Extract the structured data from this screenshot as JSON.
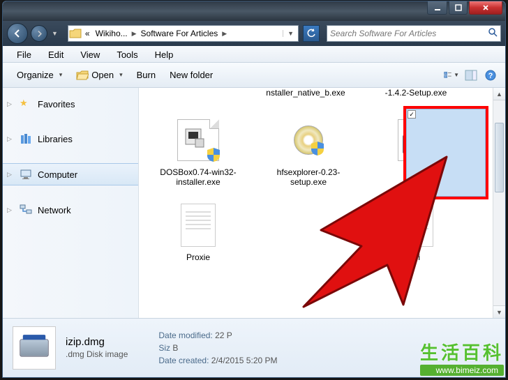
{
  "titlebar": {},
  "nav": {
    "chevrons": "«",
    "crumb1": "Wikiho...",
    "crumb2": "Software For Articles"
  },
  "search": {
    "placeholder": "Search Software For Articles"
  },
  "menu": {
    "file": "File",
    "edit": "Edit",
    "view": "View",
    "tools": "Tools",
    "help": "Help"
  },
  "toolbar": {
    "organize": "Organize",
    "open": "Open",
    "burn": "Burn",
    "newfolder": "New folder"
  },
  "sidebar": {
    "items": [
      {
        "label": "Favorites"
      },
      {
        "label": "Libraries"
      },
      {
        "label": "Computer"
      },
      {
        "label": "Network"
      }
    ]
  },
  "files": {
    "partial1": "nstaller_native_b.exe",
    "partial2": "-1.4.2-Setup.exe",
    "item1": "DOSBox0.74-win32-installer.exe",
    "item2": "hfsexplorer-0.23-setup.exe",
    "item3": "izip.dmg",
    "item4": "Proxie",
    "item5": "ini"
  },
  "details": {
    "filename": "izip.dmg",
    "filetype": ".dmg Disk image",
    "modified_label": "Date modified:",
    "modified_value": "22 P",
    "size_label": "Siz",
    "size_value": "B",
    "created_label": "Date created:",
    "created_value": "2/4/2015 5:20 PM"
  },
  "checkmark": "✓",
  "watermark": {
    "cn": "生活百科",
    "url": "www.bimeiz.com"
  }
}
